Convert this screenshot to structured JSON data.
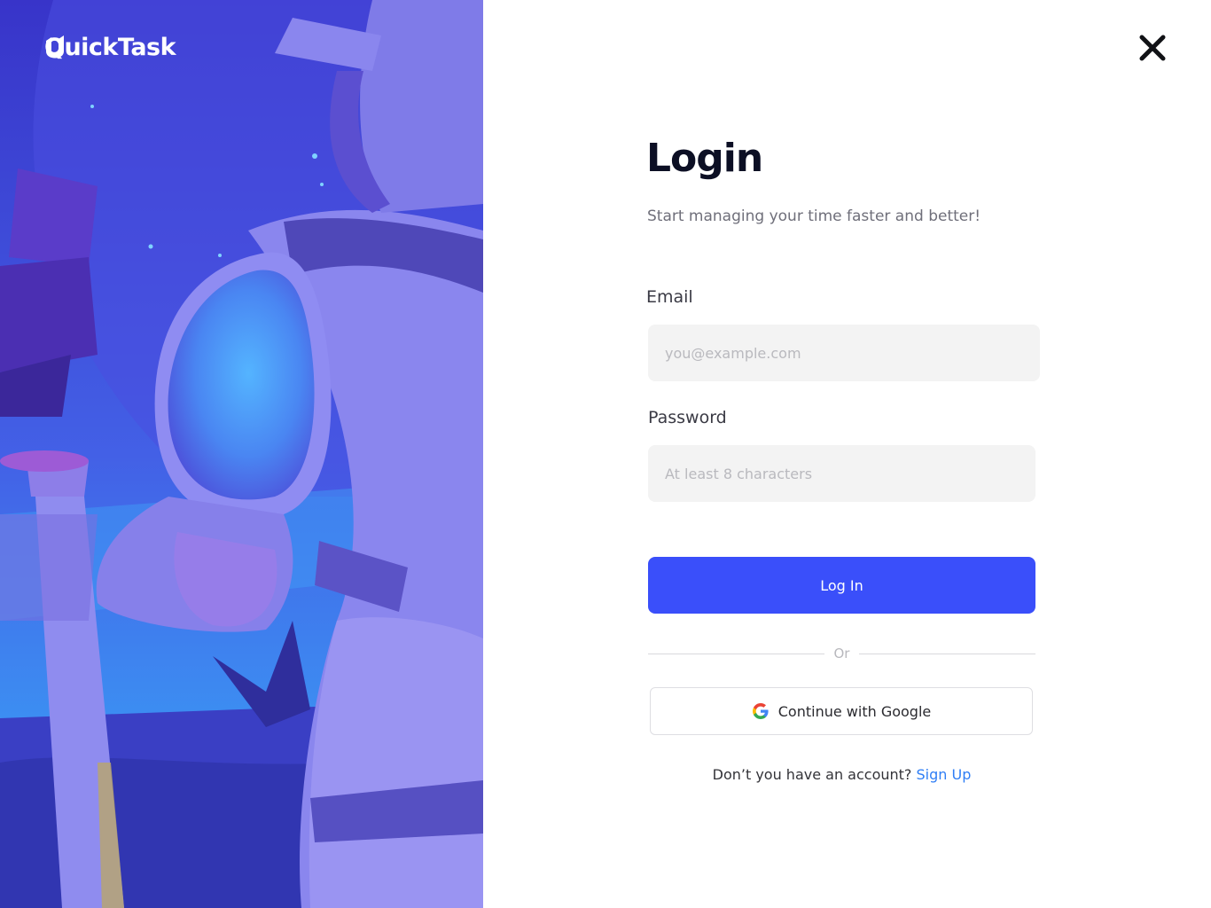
{
  "brand": {
    "name": "QuickTask"
  },
  "colors": {
    "accent": "#3a4ffa",
    "link": "#2f7ef5",
    "title": "#0c0f24",
    "input_bg": "#f3f3f3"
  },
  "illustration": {
    "description_icon": "astronaut-illustration"
  },
  "close": {
    "icon": "close-icon"
  },
  "login": {
    "title": "Login",
    "subtitle": "Start managing your time faster and better!",
    "email_label": "Email",
    "email_placeholder": "you@example.com",
    "password_label": "Password",
    "password_placeholder": "At least 8 characters",
    "submit_label": "Log In",
    "divider_text": "Or",
    "google_label": "Continue with Google",
    "signup_prompt": "Don’t you have an account?",
    "signup_link": "Sign Up"
  }
}
